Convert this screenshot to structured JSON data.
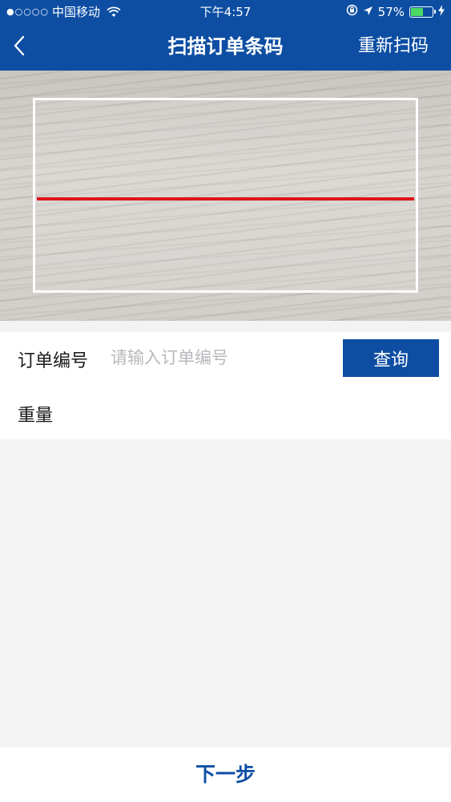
{
  "status_bar": {
    "signal": "●○○○○",
    "carrier": "中国移动",
    "time": "下午4:57",
    "battery_text": "57%",
    "battery_level": 0.57,
    "icons": [
      "wifi-icon",
      "orientation-lock-icon",
      "location-arrow-icon",
      "battery-icon",
      "charging-icon"
    ]
  },
  "nav": {
    "title": "扫描订单条码",
    "back_icon": "chevron-left-icon",
    "rescan_label": "重新扫码"
  },
  "form": {
    "order_label": "订单编号",
    "order_value": "",
    "order_placeholder": "请输入订单编号",
    "query_label": "查询",
    "weight_label": "重量"
  },
  "footer": {
    "next_label": "下一步"
  },
  "colors": {
    "primary": "#0d4ea3",
    "scan_line": "#e0141b",
    "background": "#f3f3f4"
  }
}
